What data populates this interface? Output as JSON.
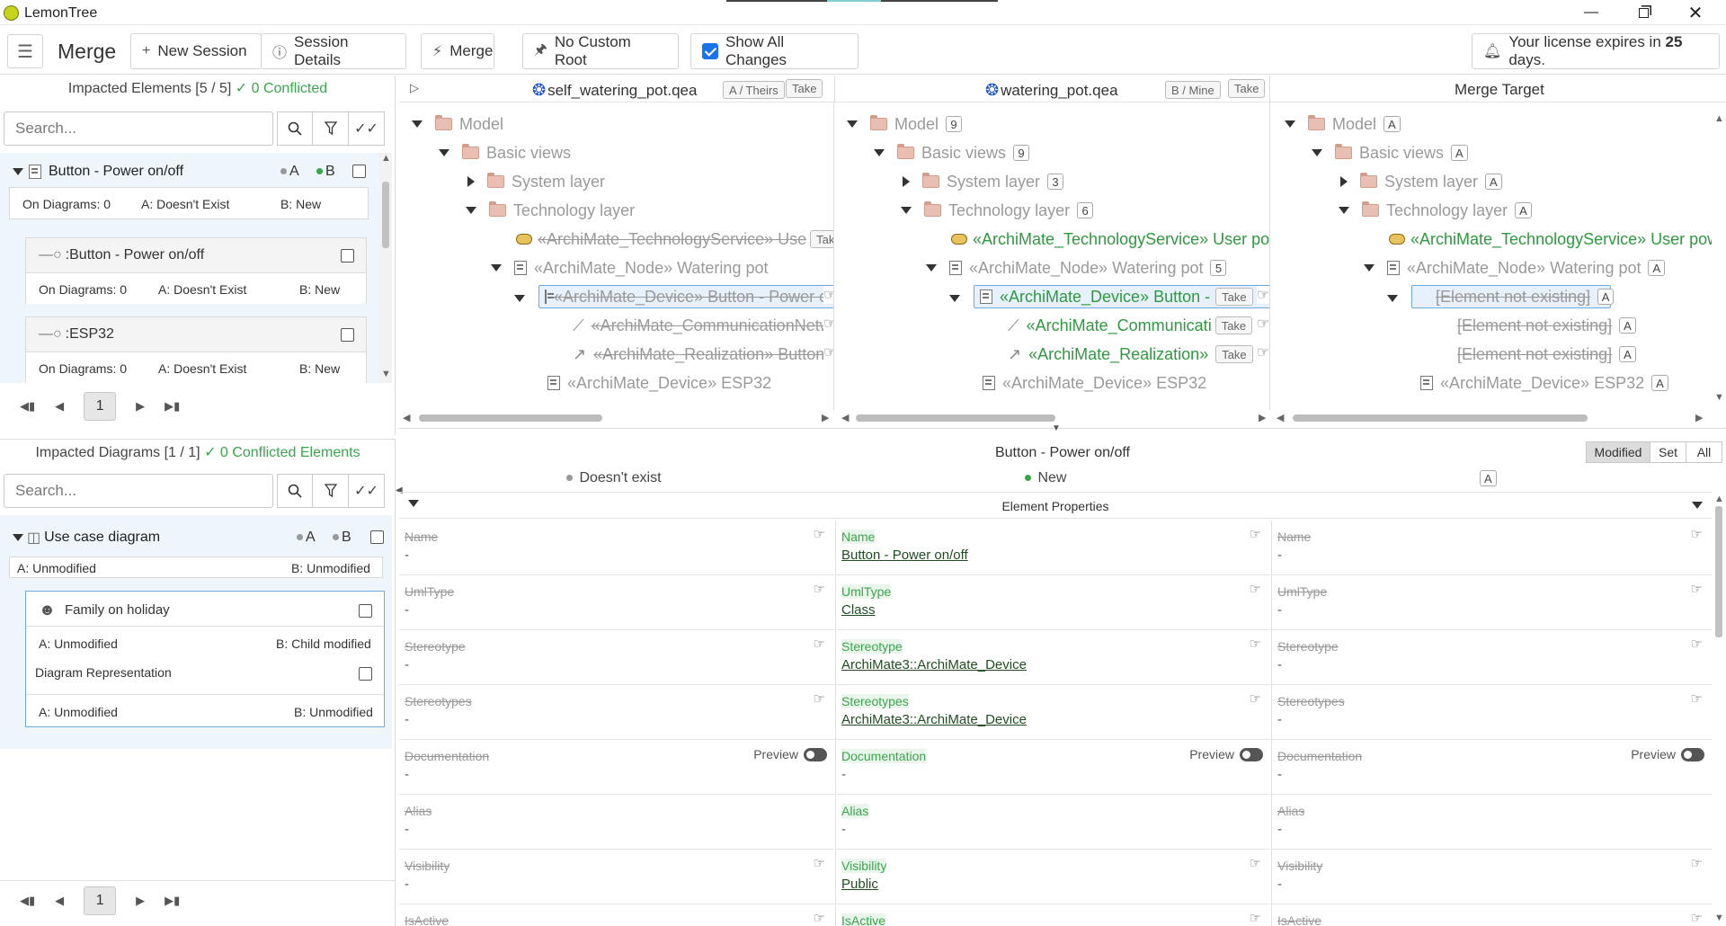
{
  "app": {
    "title": "LemonTree"
  },
  "toolbar": {
    "title": "Merge",
    "new_session": "New Session",
    "session_details": "Session Details",
    "merge": "Merge",
    "no_custom_root": "No Custom Root",
    "show_all_changes": "Show All Changes",
    "license_pre": "Your license expires in ",
    "license_days": "25",
    "license_post": " days."
  },
  "impacted_elements": {
    "header": "Impacted Elements [5 / 5]",
    "conflicted": "✓ 0 Conflicted",
    "search_placeholder": "Search...",
    "main": {
      "name": "Button - Power on/off",
      "a": "A",
      "b": "B",
      "on_diagrams": "On Diagrams: 0",
      "a_state": "A: Doesn't Exist",
      "b_state": "B: New"
    },
    "child1": {
      "name": ":Button - Power on/off",
      "on_diagrams": "On Diagrams: 0",
      "a_state": "A: Doesn't Exist",
      "b_state": "B: New"
    },
    "child2": {
      "name": ":ESP32",
      "on_diagrams": "On Diagrams: 0",
      "a_state": "A: Doesn't Exist",
      "b_state": "B: New"
    },
    "page": "1"
  },
  "impacted_diagrams": {
    "header": "Impacted Diagrams [1 / 1]",
    "conflicted": "✓ 0 Conflicted Elements",
    "search_placeholder": "Search...",
    "main": {
      "name": "Use case diagram",
      "a": "A",
      "b": "B",
      "a_state": "A: Unmodified",
      "b_state": "B: Unmodified"
    },
    "child1": {
      "name": "Family on holiday",
      "a_state": "A: Unmodified",
      "b_state": "B: Child modified"
    },
    "child2": {
      "name": "Diagram Representation",
      "a_state": "A: Unmodified",
      "b_state": "B: Unmodified"
    },
    "page": "1"
  },
  "columns": {
    "theirs": {
      "file": "self_watering_pot.qea",
      "tag": "A / Theirs",
      "take": "Take"
    },
    "mine": {
      "file": "watering_pot.qea",
      "tag": "B / Mine",
      "take": "Take"
    },
    "target": {
      "title": "Merge Target"
    }
  },
  "tree": {
    "model": "Model",
    "basic_views": "Basic views",
    "system_layer": "System layer",
    "technology_layer": "Technology layer",
    "tech_service": "«ArchiMate_TechnologyService» User power",
    "tech_service_a": "«ArchiMate_TechnologyService» Use",
    "node": "«ArchiMate_Node» Watering pot",
    "device_button": "«ArchiMate_Device» Button - Power on/off",
    "device_button_b": "«ArchiMate_Device» Button -",
    "comm": "«ArchiMate_CommunicationNetwork»",
    "comm_b": "«ArchiMate_Communicati",
    "real": "«ArchiMate_Realization» Button",
    "real_b": "«ArchiMate_Realization»",
    "esp": "«ArchiMate_Device» ESP32",
    "not_existing": "[Element not existing]",
    "take": "Take",
    "b_counts": {
      "model": "9",
      "basic_views": "9",
      "system_layer": "3",
      "technology_layer": "6",
      "node": "5"
    },
    "badge_a": "A"
  },
  "details": {
    "title": "Button - Power on/off",
    "a_state": "Doesn't exist",
    "b_state": "New",
    "target_badge": "A",
    "filters": [
      "Modified",
      "Set",
      "All"
    ],
    "section": "Element Properties",
    "props": [
      {
        "name": "Name",
        "b": "Button - Power on/off"
      },
      {
        "name": "UmlType",
        "b": "Class"
      },
      {
        "name": "Stereotype",
        "b": "ArchiMate3::ArchiMate_Device"
      },
      {
        "name": "Stereotypes",
        "b": "ArchiMate3::ArchiMate_Device"
      },
      {
        "name": "Documentation",
        "b": "-",
        "preview": "Preview"
      },
      {
        "name": "Alias",
        "b": "-"
      },
      {
        "name": "Visibility",
        "b": "Public"
      },
      {
        "name": "IsActive",
        "b": ""
      }
    ],
    "dash": "-"
  }
}
